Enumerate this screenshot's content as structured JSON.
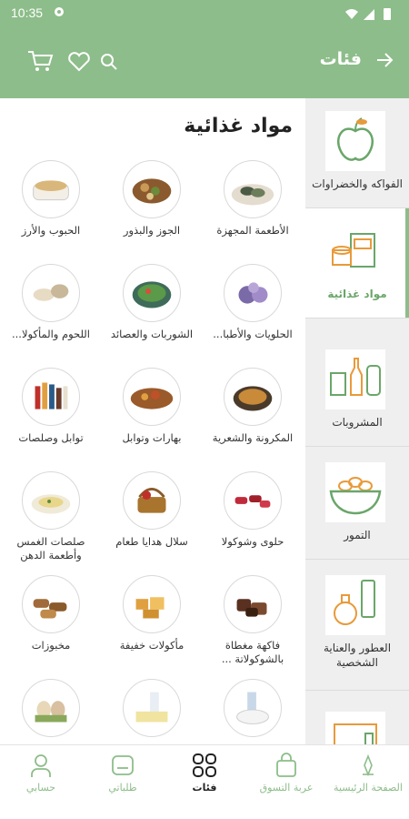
{
  "status_bar": {
    "time": "10:35"
  },
  "header": {
    "title": "فئات",
    "icons": [
      "back-arrow-icon",
      "search-icon",
      "heart-icon",
      "cart-icon"
    ]
  },
  "sidebar": {
    "items": [
      {
        "label": "الفواكه والخضراوات",
        "icon": "apple-icon",
        "active": false
      },
      {
        "label": "مواد غذائية",
        "icon": "grocery-box-icon",
        "active": true
      },
      {
        "label": "المشروبات",
        "icon": "bottles-icon",
        "active": false
      },
      {
        "label": "التمور",
        "icon": "dates-bowl-icon",
        "active": false
      },
      {
        "label": "العطور والعناية الشخصية",
        "icon": "perfume-icon",
        "active": false
      },
      {
        "label": "",
        "icon": "device-icon",
        "active": false
      }
    ]
  },
  "main": {
    "section_title": "مواد غذائية",
    "items": [
      {
        "label": "الأطعمة المجهزة",
        "icon": "prepared-food-icon"
      },
      {
        "label": "الجوز والبذور",
        "icon": "nuts-icon"
      },
      {
        "label": "الحبوب والأرز",
        "icon": "rice-icon"
      },
      {
        "label": "الحلويات والأطبا...",
        "icon": "sweets-icon"
      },
      {
        "label": "الشوربات والعصائد",
        "icon": "soup-icon"
      },
      {
        "label": "اللحوم والمأكولا...",
        "icon": "meat-icon"
      },
      {
        "label": "المكرونة والشعرية",
        "icon": "pasta-icon"
      },
      {
        "label": "بهارات وتوابل",
        "icon": "spices-icon"
      },
      {
        "label": "توابل وصلصات",
        "icon": "sauces-icon"
      },
      {
        "label": "حلوى وشوكولا",
        "icon": "candy-icon"
      },
      {
        "label": "سلال هدايا طعام",
        "icon": "gift-basket-icon"
      },
      {
        "label": "صلصات الغمس وأطعمة الدهن",
        "icon": "dips-icon"
      },
      {
        "label": "فاكهة مغطاة بالشوكولاتة ...",
        "icon": "choco-fruit-icon"
      },
      {
        "label": "مأكولات خفيفة",
        "icon": "snacks-icon"
      },
      {
        "label": "مخبوزات",
        "icon": "bakery-icon"
      },
      {
        "label": "",
        "icon": "dairy-icon"
      },
      {
        "label": "",
        "icon": "milk-icon"
      },
      {
        "label": "",
        "icon": "eggs-icon"
      }
    ]
  },
  "bottom_nav": {
    "items": [
      {
        "label": "الصفحة الرئيسية",
        "icon": "home-logo-icon",
        "active": false
      },
      {
        "label": "عربة التسوق",
        "icon": "shopping-bag-icon",
        "active": false
      },
      {
        "label": "فئات",
        "icon": "grid-icon",
        "active": true
      },
      {
        "label": "طلباتي",
        "icon": "orders-icon",
        "active": false
      },
      {
        "label": "حسابي",
        "icon": "person-icon",
        "active": false
      }
    ]
  },
  "colors": {
    "brand": "#8dbd8a",
    "active_text": "#6aa66a",
    "sidebar_bg": "#efefef"
  }
}
